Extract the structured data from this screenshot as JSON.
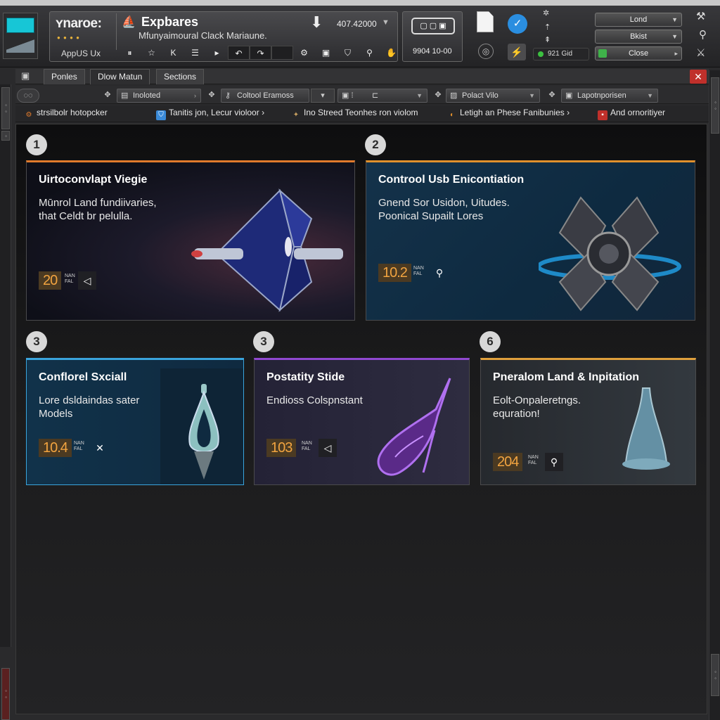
{
  "toolbar": {
    "brand": "ʏnaroe:",
    "brand_sub": "AppUS Ux",
    "player_title": "Expbares",
    "player_subtitle": "Mfunyaimoural Clack Mariaune.",
    "player_counter": "407.42000",
    "box_number": "9904 10-00",
    "status_pill": "921 Gid",
    "dropdowns": [
      "Lond",
      "Bkist",
      "Close"
    ]
  },
  "tabs": [
    "Ponles",
    "Dlow Matun",
    "Sections"
  ],
  "filters": [
    "Inoloted",
    "Coltool Eramoss",
    "",
    "Polact Vilo",
    "Lapotnporisen"
  ],
  "links": [
    {
      "label": "strsilbolr hotopcker",
      "color": "#e07a2c"
    },
    {
      "label": "Tanitis jon, Lecur violoor ›",
      "color": "#3a8ad8"
    },
    {
      "label": "Ino Streed Teonhes ron violom",
      "color": "#c8a060"
    },
    {
      "label": "Letigh an Phese Fanibunies ›",
      "color": "#e0902c"
    },
    {
      "label": "And ornoritiyer",
      "color": "#c0302b"
    }
  ],
  "cards": [
    {
      "badge": "1",
      "title": "Uirtoconvlapt Viegie",
      "desc": [
        "Mūnrol  Land fundiivaries,",
        "that Celdt br pelulla."
      ],
      "value": "20",
      "unit": [
        "NAN",
        "FAL"
      ],
      "action_icon": "speaker-icon"
    },
    {
      "badge": "2",
      "title": "Controol Usb Enicontiation",
      "desc": [
        "Gnend Sor Usidon, Uitudes.",
        "Poonical Supailt Lores"
      ],
      "value": "10.2",
      "unit": [
        "NAN",
        "FAL"
      ],
      "action_icon": "search-icon"
    },
    {
      "badge": "3",
      "title": "Conflorel Sxciall",
      "desc": [
        "Lore dsldaindas sater",
        "Models"
      ],
      "value": "10.4",
      "unit": [
        "NAN",
        "FAL"
      ],
      "action_icon": "close-icon"
    },
    {
      "badge": "3",
      "title": "Postatity Stide",
      "desc": [
        "Endioss Colspnstant"
      ],
      "value": "103",
      "unit": [
        "NAN",
        "FAL"
      ],
      "action_icon": "speaker-icon"
    },
    {
      "badge": "6",
      "title": "Pneralom Land & Inpitation",
      "desc": [
        "Eolt-Onpaleretngs.",
        "equration!"
      ],
      "value": "204",
      "unit": [
        "NAN",
        "FAL"
      ],
      "action_icon": "search-icon"
    }
  ]
}
